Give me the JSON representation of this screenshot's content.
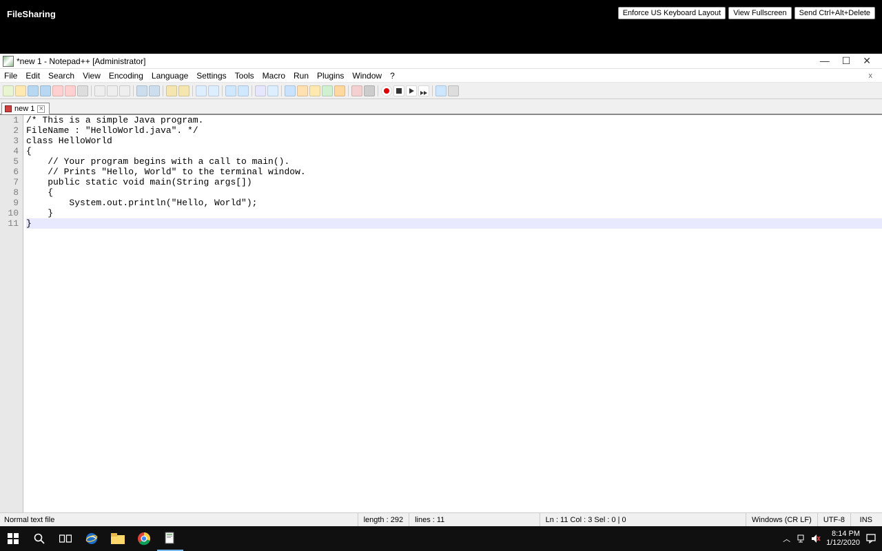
{
  "host": {
    "label": "FileSharing",
    "buttons": [
      "Enforce US Keyboard Layout",
      "View Fullscreen",
      "Send Ctrl+Alt+Delete"
    ]
  },
  "window": {
    "title": "*new 1 - Notepad++ [Administrator]"
  },
  "menu": {
    "items": [
      "File",
      "Edit",
      "Search",
      "View",
      "Encoding",
      "Language",
      "Settings",
      "Tools",
      "Macro",
      "Run",
      "Plugins",
      "Window",
      "?"
    ],
    "close": "x"
  },
  "tabs": [
    {
      "label": "new 1"
    }
  ],
  "code": {
    "lines": [
      "/* This is a simple Java program.",
      "FileName : \"HelloWorld.java\". */",
      "class HelloWorld",
      "{",
      "    // Your program begins with a call to main().",
      "    // Prints \"Hello, World\" to the terminal window.",
      "    public static void main(String args[])",
      "    {",
      "        System.out.println(\"Hello, World\");",
      "    }",
      "}"
    ],
    "current_line_index": 10
  },
  "status": {
    "filetype": "Normal text file",
    "length": "length : 292",
    "lines": "lines : 11",
    "pos": "Ln : 11   Col : 3   Sel : 0 | 0",
    "eol": "Windows (CR LF)",
    "enc": "UTF-8",
    "mode": "INS"
  },
  "tray": {
    "time": "8:14 PM",
    "date": "1/12/2020"
  },
  "toolbar_icons": [
    "new",
    "open",
    "save",
    "save-all",
    "close",
    "close-all",
    "print",
    "sep",
    "cut",
    "copy",
    "paste",
    "sep",
    "undo",
    "redo",
    "sep",
    "find",
    "replace",
    "sep",
    "zoom-in",
    "zoom-out",
    "sep",
    "sync-v",
    "sync-h",
    "sep",
    "wrap",
    "all-chars",
    "sep",
    "indent-guide",
    "lang",
    "fold",
    "unfold",
    "folder",
    "sep",
    "doc-map",
    "func-list",
    "sep",
    "record",
    "stop",
    "play",
    "play-multi",
    "sep",
    "macro-save",
    "monitor"
  ],
  "toolbar_colors": {
    "new": "#e8f5d0",
    "open": "#ffe9b0",
    "save": "#b7d7f3",
    "save-all": "#b7d7f3",
    "close": "#ffd0d0",
    "close-all": "#ffd0d0",
    "print": "#ddd",
    "cut": "#eee",
    "copy": "#eee",
    "paste": "#eee",
    "undo": "#cde",
    "redo": "#cde",
    "find": "#f5e6b0",
    "replace": "#f5e6b0",
    "zoom-in": "#def",
    "zoom-out": "#def",
    "sync-v": "#d0e8ff",
    "sync-h": "#d0e8ff",
    "wrap": "#e6e6ff",
    "all-chars": "#dceeff",
    "indent-guide": "#c9e2ff",
    "lang": "#ffe0b0",
    "fold": "#ffe9b0",
    "unfold": "#d0f0d0",
    "folder": "#ffd8a0",
    "doc-map": "#f5d0d0",
    "func-list": "#ccc",
    "record": "#f00",
    "stop": "#fff",
    "play": "#fff",
    "play-multi": "#fff",
    "macro-save": "#cde6ff",
    "monitor": "#ddd"
  }
}
